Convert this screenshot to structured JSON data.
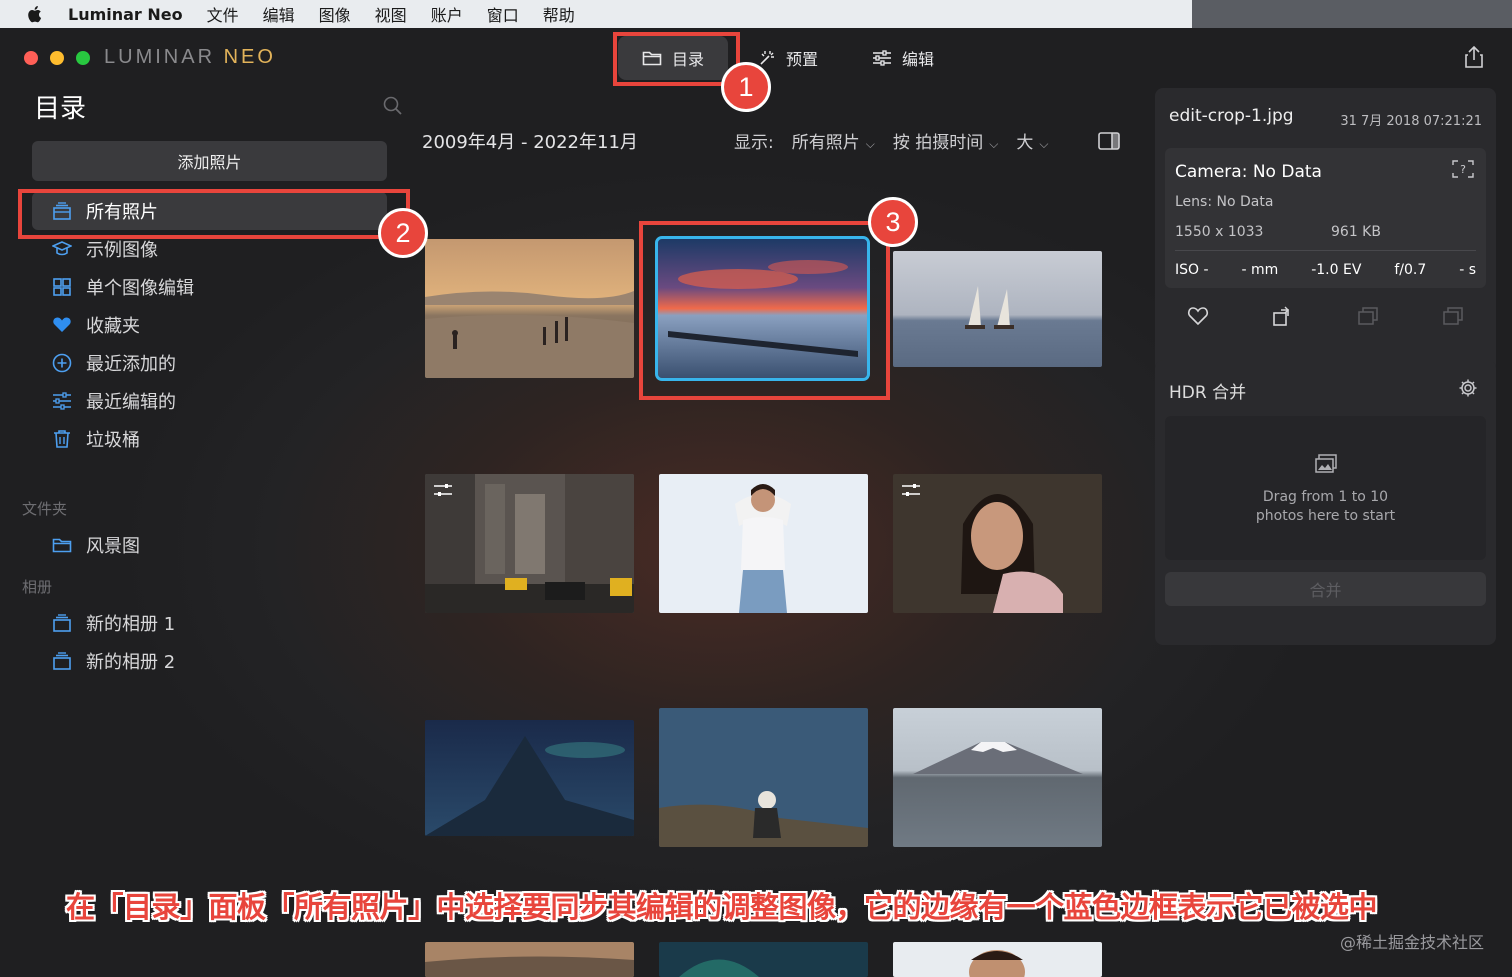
{
  "menubar": {
    "app_name": "Luminar Neo",
    "items": [
      "文件",
      "编辑",
      "图像",
      "视图",
      "账户",
      "窗口",
      "帮助"
    ]
  },
  "logo": {
    "part1": "LUMINAR ",
    "part2": "NEO"
  },
  "tabs": [
    {
      "label": "目录",
      "icon": "folder-icon",
      "active": true
    },
    {
      "label": "预置",
      "icon": "presets-icon",
      "active": false
    },
    {
      "label": "编辑",
      "icon": "sliders-icon",
      "active": false
    }
  ],
  "sidebar": {
    "title": "目录",
    "add_button": "添加照片",
    "items": [
      {
        "label": "所有照片",
        "icon": "photos-stack-icon",
        "active": true
      },
      {
        "label": "示例图像",
        "icon": "graduation-cap-icon"
      },
      {
        "label": "单个图像编辑",
        "icon": "grid-icon"
      },
      {
        "label": "收藏夹",
        "icon": "heart-icon"
      },
      {
        "label": "最近添加的",
        "icon": "plus-circle-icon"
      },
      {
        "label": "最近编辑的",
        "icon": "sliders-icon"
      },
      {
        "label": "垃圾桶",
        "icon": "trash-icon"
      }
    ],
    "folders_label": "文件夹",
    "folders": [
      {
        "label": "风景图",
        "icon": "folder-icon"
      }
    ],
    "albums_label": "相册",
    "albums": [
      {
        "label": "新的相册 1",
        "icon": "album-icon"
      },
      {
        "label": "新的相册 2",
        "icon": "album-icon"
      }
    ]
  },
  "toolbar": {
    "date_range": "2009年4月 - 2022年11月",
    "show_label": "显示:",
    "show_value": "所有照片",
    "sort_label": "按 拍摄时间",
    "size_label": "大"
  },
  "info": {
    "filename": "edit-crop-1.jpg",
    "date": "31 7月 2018 07:21:21",
    "camera": "Camera: No Data",
    "lens": "Lens: No Data",
    "dimensions": "1550 x 1033",
    "filesize": "961 KB",
    "iso": "ISO -",
    "focal": "- mm",
    "ev": "-1.0 EV",
    "aperture": "f/0.7",
    "shutter": "- s"
  },
  "hdr": {
    "title": "HDR 合并",
    "drop_line1": "Drag from 1 to 10",
    "drop_line2": "photos here to start",
    "merge_button": "合并"
  },
  "annotations": {
    "n1": "1",
    "n2": "2",
    "n3": "3"
  },
  "caption": "在「目录」面板「所有照片」中选择要同步其编辑的调整图像，它的边缘有一个蓝色边框表示它已被选中",
  "watermark": "@稀土掘金技术社区",
  "colors": {
    "accent_red": "#e8453c",
    "selection_blue": "#38b5ec"
  }
}
